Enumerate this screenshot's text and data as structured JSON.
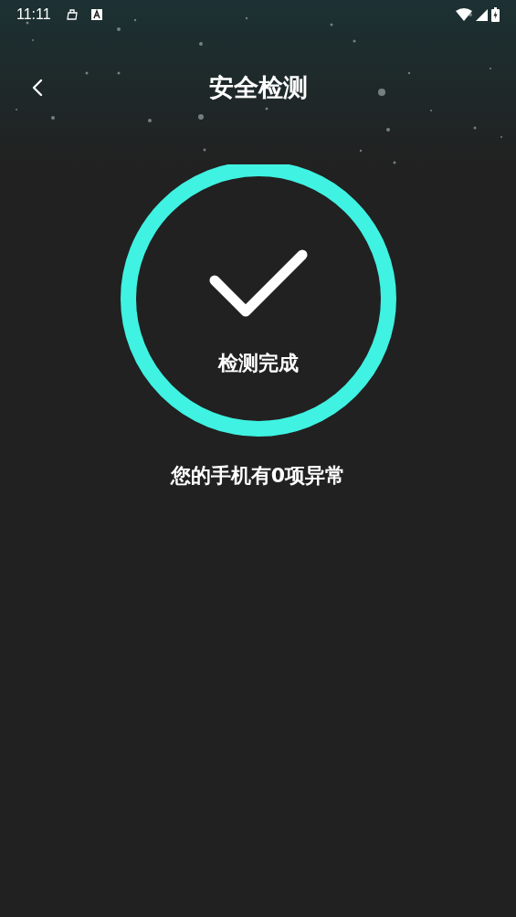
{
  "status_bar": {
    "time": "11:11"
  },
  "header": {
    "title": "安全检测"
  },
  "result": {
    "status": "检测完成",
    "summary": "您的手机有0项异常"
  }
}
